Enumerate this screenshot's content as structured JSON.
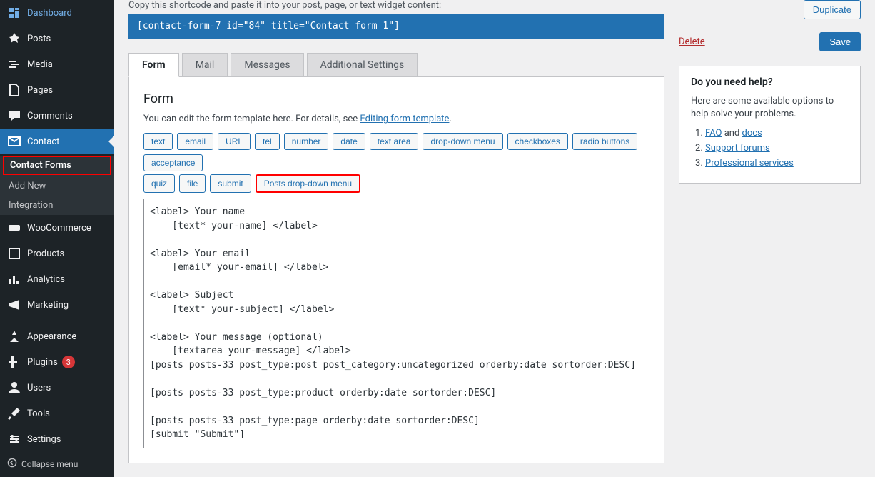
{
  "sidebar": {
    "items": [
      {
        "label": "Dashboard",
        "icon": "dashboard-icon"
      },
      {
        "label": "Posts",
        "icon": "pin-icon"
      },
      {
        "label": "Media",
        "icon": "media-icon"
      },
      {
        "label": "Pages",
        "icon": "pages-icon"
      },
      {
        "label": "Comments",
        "icon": "comments-icon"
      },
      {
        "label": "Contact",
        "icon": "mail-icon",
        "active": true
      },
      {
        "label": "WooCommerce",
        "icon": "woo-icon"
      },
      {
        "label": "Products",
        "icon": "products-icon"
      },
      {
        "label": "Analytics",
        "icon": "analytics-icon"
      },
      {
        "label": "Marketing",
        "icon": "marketing-icon"
      },
      {
        "label": "Appearance",
        "icon": "appearance-icon"
      },
      {
        "label": "Plugins",
        "icon": "plugins-icon",
        "badge": "3"
      },
      {
        "label": "Users",
        "icon": "users-icon"
      },
      {
        "label": "Tools",
        "icon": "tools-icon"
      },
      {
        "label": "Settings",
        "icon": "settings-icon"
      }
    ],
    "submenu": [
      {
        "label": "Contact Forms",
        "current": true,
        "highlighted": true
      },
      {
        "label": "Add New"
      },
      {
        "label": "Integration"
      }
    ],
    "collapse": "Collapse menu"
  },
  "intro": "Copy this shortcode and paste it into your post, page, or text widget content:",
  "shortcode": "[contact-form-7 id=\"84\" title=\"Contact form 1\"]",
  "tabs": [
    {
      "label": "Form",
      "active": true
    },
    {
      "label": "Mail"
    },
    {
      "label": "Messages"
    },
    {
      "label": "Additional Settings"
    }
  ],
  "panel": {
    "title": "Form",
    "desc_prefix": "You can edit the form template here. For details, see ",
    "desc_link": "Editing form template",
    "tag_buttons_row1": [
      "text",
      "email",
      "URL",
      "tel",
      "number",
      "date",
      "text area",
      "drop-down menu",
      "checkboxes",
      "radio buttons",
      "acceptance"
    ],
    "tag_buttons_row2": [
      "quiz",
      "file",
      "submit",
      "Posts drop-down menu"
    ],
    "highlighted_tag": "Posts drop-down menu",
    "code": "<label> Your name\n    [text* your-name] </label>\n\n<label> Your email\n    [email* your-email] </label>\n\n<label> Subject\n    [text* your-subject] </label>\n\n<label> Your message (optional)\n    [textarea your-message] </label>\n[posts posts-33 post_type:post post_category:uncategorized orderby:date sortorder:DESC]\n\n[posts posts-33 post_type:product orderby:date sortorder:DESC]\n\n[posts posts-33 post_type:page orderby:date sortorder:DESC]\n[submit \"Submit\"]"
  },
  "actions": {
    "duplicate": "Duplicate",
    "delete": "Delete",
    "save": "Save"
  },
  "help": {
    "title": "Do you need help?",
    "desc": "Here are some available options to help solve your problems.",
    "items": [
      {
        "prefix": "",
        "link1": "FAQ",
        "mid": " and ",
        "link2": "docs"
      },
      {
        "link1": "Support forums"
      },
      {
        "link1": "Professional services"
      }
    ]
  }
}
